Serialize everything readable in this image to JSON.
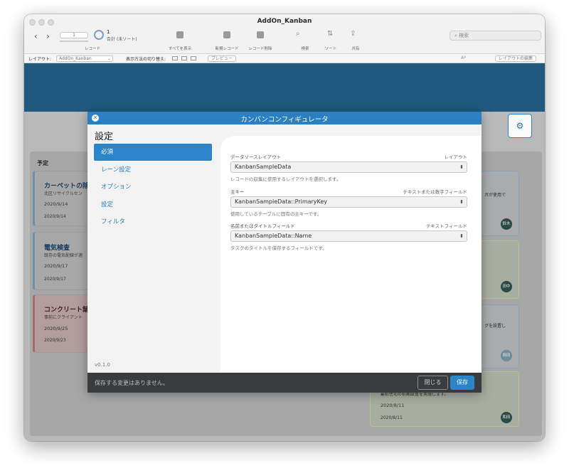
{
  "window": {
    "title": "AddOn_Kanban"
  },
  "toolbar": {
    "record_current": "1",
    "record_count": "1",
    "record_total_label": "合計 (未ソート)",
    "record_label": "レコード",
    "show_all": "すべてを表示",
    "new_record": "新規レコード",
    "delete_record": "レコード削除",
    "find": "検索",
    "sort": "ソート",
    "share": "共有",
    "search_placeholder": "検索"
  },
  "layout_bar": {
    "layout_label": "レイアウト:",
    "layout_value": "AddOn_Kanban",
    "view_switch_label": "表示方法の切り替え:",
    "preview": "プレビュー",
    "font_size_icon": "Aª",
    "edit_layout": "レイアウトの編集"
  },
  "board": {
    "lane_title": "予定",
    "cards": [
      {
        "title": "カーペットの除",
        "desc": "北区リサイクルセン",
        "date1": "2020/9/14",
        "date2": "2020/9/14"
      },
      {
        "title": "電気検査",
        "desc": "既存の電気配線が適",
        "date1": "2020/9/17",
        "date2": "2020/9/17"
      },
      {
        "title": "コンクリート舗",
        "desc": "事前にクライアント",
        "date1": "2020/9/25",
        "date2": "2020/9/23"
      }
    ],
    "right_cards": [
      {
        "text": "ガが使用で",
        "avatar": "鈴木"
      },
      {
        "text": "",
        "avatar": "田中"
      },
      {
        "text": "グを設置し",
        "avatar": "岡田"
      },
      {
        "text": "最初住宅の初期設置を実施します。",
        "date1": "2020/8/11",
        "date2": "2020/8/11",
        "avatar": "和田"
      }
    ]
  },
  "modal": {
    "title": "カンバンコンフィギュレータ",
    "heading": "設定",
    "nav": [
      {
        "label": "必須",
        "active": true
      },
      {
        "label": "レーン設定"
      },
      {
        "label": "オプション"
      },
      {
        "label": "設定"
      },
      {
        "label": "フィルタ"
      }
    ],
    "version": "v0.1.0",
    "fields": [
      {
        "label": "データソースレイアウト",
        "type": "レイアウト",
        "value": "KanbanSampleData",
        "help": "レコードの収集に使用するレイアウトを選択します。"
      },
      {
        "label": "主キー",
        "type": "テキストまたは数字フィールド",
        "value": "KanbanSampleData::PrimaryKey",
        "help": "使用しているテーブルに固有の主キーです。"
      },
      {
        "label": "名前またはタイトルフィールド",
        "type": "テキストフィールド",
        "value": "KanbanSampleData::Name",
        "help": "タスクのタイトルを保存するフィールドです。"
      }
    ],
    "footer_message": "保存する変更はありません。",
    "close_button": "閉じる",
    "save_button": "保存"
  }
}
